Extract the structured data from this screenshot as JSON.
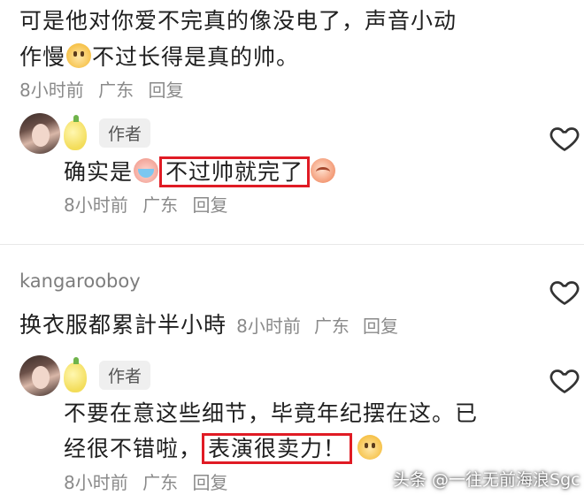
{
  "comment1": {
    "line1": "可是他对你爱不完真的像没电了，声音小动",
    "line2_prefix": "作慢",
    "line2_suffix": "不过长得是真的帅。",
    "time": "8小时前",
    "location": "广东",
    "reply": "回复"
  },
  "reply1": {
    "author_badge": "作者",
    "text_prefix": "确实是",
    "highlight": "不过帅就完了",
    "time": "8小时前",
    "location": "广东",
    "reply": "回复"
  },
  "comment2": {
    "username": "kangarooboy",
    "text": "换衣服都累計半小時",
    "time": "8小时前",
    "location": "广东",
    "reply": "回复"
  },
  "reply2": {
    "author_badge": "作者",
    "line1": "不要在意这些细节，毕竟年纪摆在这。已",
    "line2_prefix": "经很不错啦，",
    "highlight": "表演很卖力！",
    "time": "8小时前",
    "location": "广东",
    "reply": "回复"
  },
  "watermark": "头条 @一往无前海浪Sgc",
  "colors": {
    "highlight_border": "#e01b24",
    "meta_text": "#8a8a8a",
    "badge_bg": "#efefef"
  },
  "icons": [
    "heart-outline-icon",
    "avatar",
    "lemon-icon",
    "dog-emoji",
    "crying-emoji",
    "peach-emoji"
  ]
}
